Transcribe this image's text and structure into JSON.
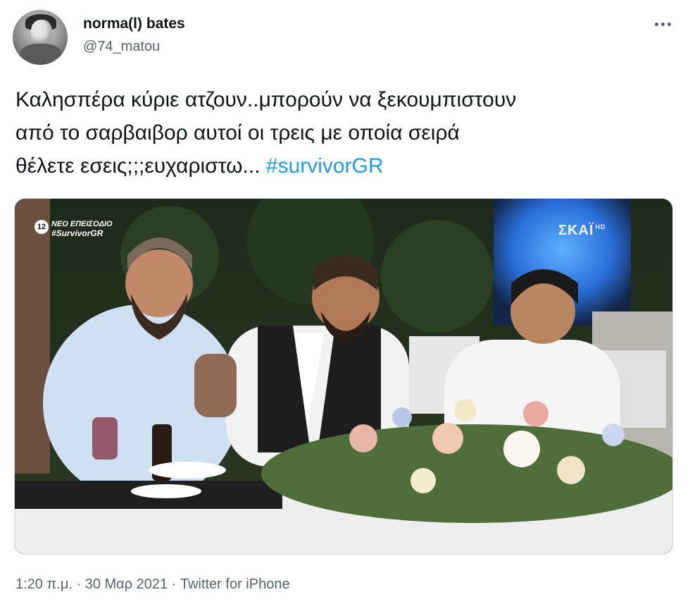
{
  "user": {
    "display_name": "norma(l) bates",
    "handle": "@74_matou"
  },
  "tweet": {
    "lines": [
      "Καλησπέρα κύριε ατζουν..μπορούν να ξεκουμπιστουν",
      "από το σαρβαιβορ αυτοί οι τρεις με οποία σειρά",
      "θέλετε εσεις;;;ευχαριστω..."
    ],
    "hashtag": "#survivorGR"
  },
  "media": {
    "overlay_rating": "12",
    "overlay_line1": "ΝΕΟ ΕΠΕΙΣΟΔΙΟ",
    "overlay_line2": "#SurvivorGR",
    "logo_text": "ΣΚΑΪ",
    "logo_hd": "HD"
  },
  "footer": {
    "time": "1:20 π.μ.",
    "separator1": " · ",
    "date": "30 Μαρ 2021",
    "separator2": " · ",
    "source": "Twitter for iPhone"
  },
  "colors": {
    "text_primary": "#0f1419",
    "text_secondary": "#536471",
    "link": "#1d9bf0"
  },
  "icons": {
    "more": "more-horizontal-icon"
  }
}
